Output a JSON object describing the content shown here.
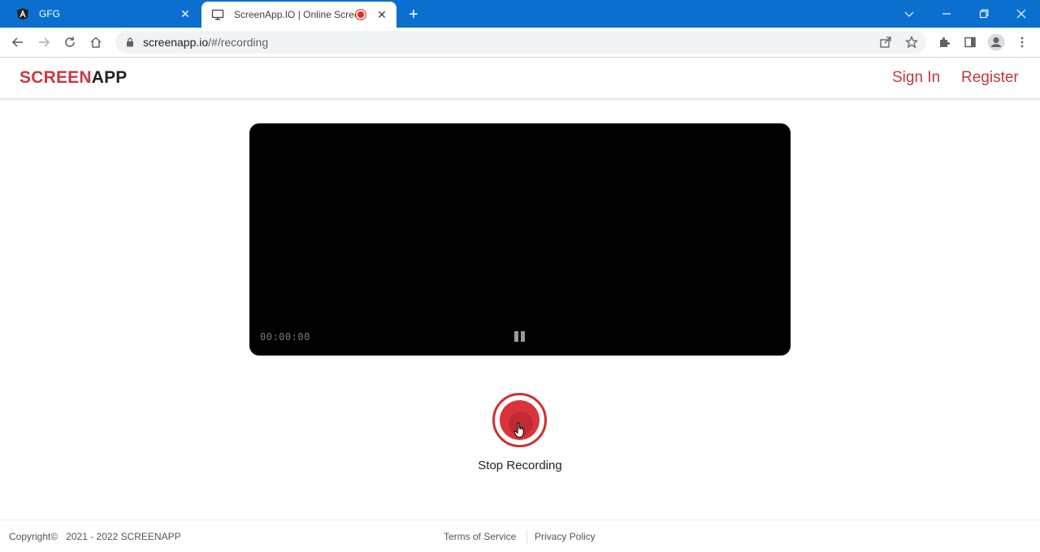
{
  "browser": {
    "tabs": [
      {
        "title": "GFG",
        "icon": "angular-icon",
        "active": false
      },
      {
        "title": "ScreenApp.IO | Online Screen",
        "icon": "monitor-icon",
        "active": true,
        "recording": true
      }
    ],
    "new_tab_label": "+",
    "address": {
      "host": "screenapp.io",
      "path": "/#/recording"
    }
  },
  "site": {
    "logo_red": "SCREEN",
    "logo_dark": "APP",
    "nav": {
      "sign_in": "Sign In",
      "register": "Register"
    },
    "brand_color": "#c63a3f"
  },
  "player": {
    "timer": "00:00:00",
    "state": "recording"
  },
  "record": {
    "label": "Stop Recording",
    "accent": "#d32f2f"
  },
  "footer": {
    "copyright": "Copyright©   2021 - 2022 SCREENAPP",
    "terms": "Terms of Service",
    "privacy": "Privacy Policy"
  }
}
